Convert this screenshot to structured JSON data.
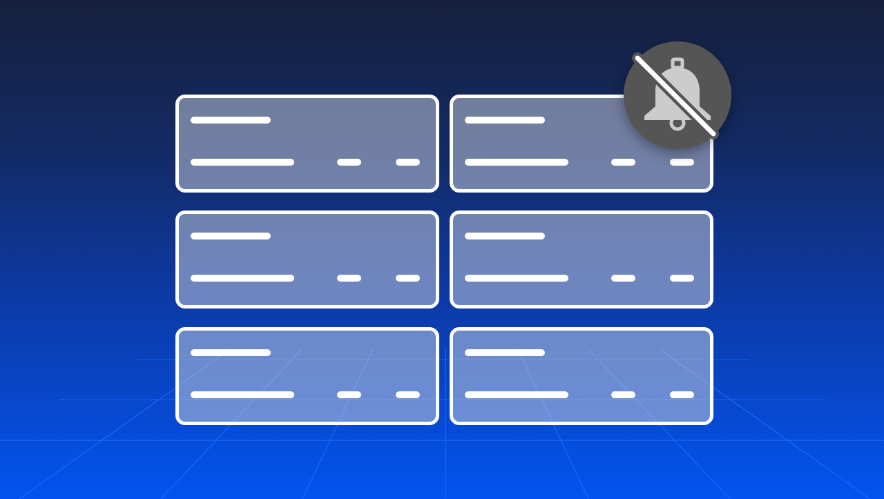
{
  "scene": {
    "background_top": "#15203c",
    "background_bottom": "#0354f0",
    "grid_line_color": "#1c74ff"
  },
  "cards": [
    {
      "id": "card-1"
    },
    {
      "id": "card-2"
    },
    {
      "id": "card-3"
    },
    {
      "id": "card-4"
    },
    {
      "id": "card-5"
    },
    {
      "id": "card-6"
    }
  ],
  "badge": {
    "icon": "bell-off-icon",
    "background": "#555555",
    "icon_color": "#cccccc",
    "strike_color": "#ffffff"
  }
}
